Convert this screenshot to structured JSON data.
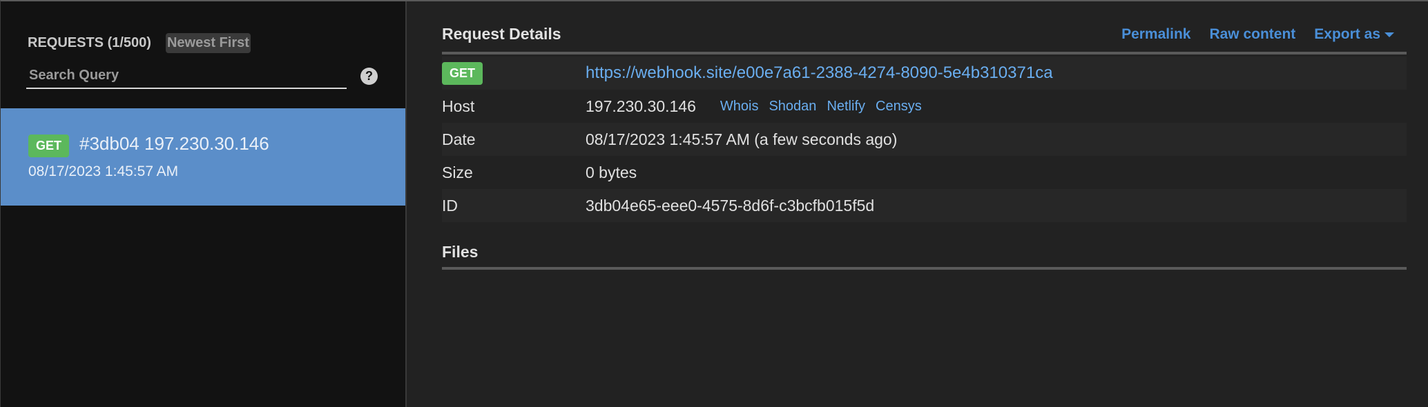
{
  "sidebar": {
    "requests_title": "REQUESTS (1/500)",
    "sort_label": "Newest First",
    "search_placeholder": "Search Query",
    "help_icon_glyph": "?",
    "requests": [
      {
        "method": "GET",
        "id_ip": "#3db04 197.230.30.146",
        "date": "08/17/2023 1:45:57 AM"
      }
    ]
  },
  "main": {
    "details_title": "Request Details",
    "links": {
      "permalink": "Permalink",
      "raw_content": "Raw content",
      "export_as": "Export as"
    },
    "method": "GET",
    "url": "https://webhook.site/e00e7a61-2388-4274-8090-5e4b310371ca",
    "rows": {
      "host": {
        "label": "Host",
        "value": "197.230.30.146"
      },
      "date": {
        "label": "Date",
        "value": "08/17/2023 1:45:57 AM (a few seconds ago)"
      },
      "size": {
        "label": "Size",
        "value": "0 bytes"
      },
      "id": {
        "label": "ID",
        "value": "3db04e65-eee0-4575-8d6f-c3bcfb015f5d"
      }
    },
    "host_links": [
      "Whois",
      "Shodan",
      "Netlify",
      "Censys"
    ],
    "files_title": "Files"
  },
  "colors": {
    "accent_blue": "#4a8fd8",
    "selected_row": "#5b8ec9",
    "get_badge": "#5cb85c"
  }
}
